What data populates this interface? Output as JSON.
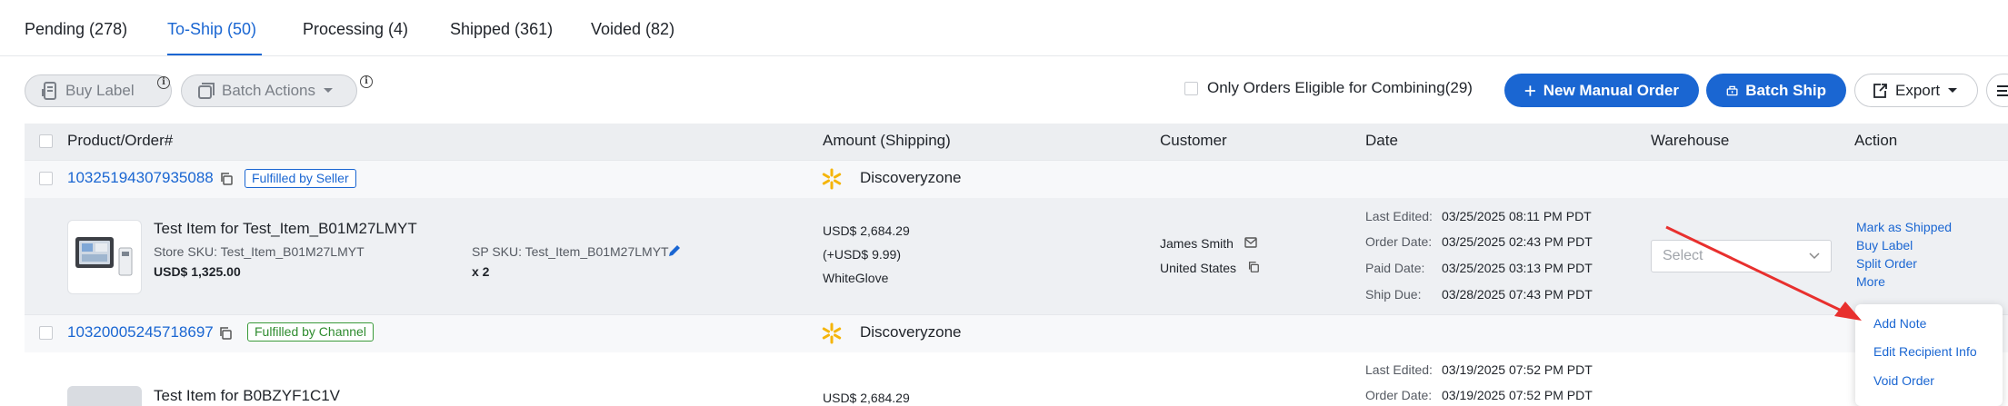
{
  "tabs": [
    {
      "label": "Pending (278)"
    },
    {
      "label": "To-Ship (50)"
    },
    {
      "label": "Processing (4)"
    },
    {
      "label": "Shipped (361)"
    },
    {
      "label": "Voided (82)"
    }
  ],
  "toolbar": {
    "buy_label": "Buy Label",
    "batch_actions": "Batch Actions",
    "combine_filter": "Only Orders Eligible for Combining(29)",
    "new_manual_order": "New Manual Order",
    "batch_ship": "Batch Ship",
    "export": "Export"
  },
  "table": {
    "headers": {
      "product": "Product/Order#",
      "amount": "Amount (Shipping)",
      "customer": "Customer",
      "date": "Date",
      "warehouse": "Warehouse",
      "action": "Action"
    }
  },
  "orders": [
    {
      "order_no": "10325194307935088",
      "fulfillment": "Fulfilled by Seller",
      "store": "Discoveryzone",
      "item": {
        "title": "Test Item for Test_Item_B01M27LMYT",
        "store_sku": "Store SKU: Test_Item_B01M27LMYT",
        "price": "USD$ 1,325.00",
        "sp_sku": "SP SKU: Test_Item_B01M27LMYT",
        "qty": "x 2"
      },
      "amount": "USD$ 2,684.29",
      "shipping": "(+USD$ 9.99)",
      "service": "WhiteGlove",
      "customer_name": "James Smith",
      "customer_country": "United States",
      "dates": [
        {
          "label": "Last Edited:",
          "value": "03/25/2025 08:11 PM PDT"
        },
        {
          "label": "Order Date:",
          "value": "03/25/2025 02:43 PM PDT"
        },
        {
          "label": "Paid Date:",
          "value": "03/25/2025 03:13 PM PDT"
        },
        {
          "label": "Ship Due:",
          "value": "03/28/2025 07:43 PM PDT"
        }
      ],
      "warehouse_placeholder": "Select",
      "actions": [
        "Mark as Shipped",
        "Buy Label",
        "Split Order",
        "More"
      ]
    },
    {
      "order_no": "10320005245718697",
      "fulfillment": "Fulfilled by Channel",
      "store": "Discoveryzone",
      "item": {
        "title": "Test Item for B0BZYF1C1V"
      },
      "amount": "USD$ 2,684.29",
      "dates": [
        {
          "label": "Last Edited:",
          "value": "03/19/2025 07:52 PM PDT"
        },
        {
          "label": "Order Date:",
          "value": "03/19/2025 07:52 PM PDT"
        }
      ]
    }
  ],
  "more_menu": [
    "Add Note",
    "Edit Recipient Info",
    "Void Order"
  ],
  "colors": {
    "accent": "#1a66d2",
    "walmart_spark": "#f5b50a",
    "arrow": "#e8302e"
  }
}
